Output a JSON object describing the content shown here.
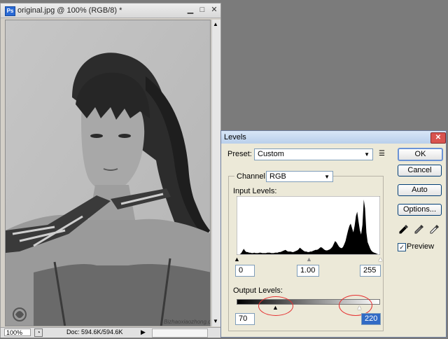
{
  "document": {
    "ps_icon_label": "Ps",
    "title": "original.jpg @ 100% (RGB/8) *",
    "zoom": "100%",
    "status": "Doc: 594.6K/594.6K",
    "watermark": "Bizhaoxiaozhong.com.vn"
  },
  "levels": {
    "title": "Levels",
    "preset_label": "Preset:",
    "preset_value": "Custom",
    "channel_label": "Channel:",
    "channel_value": "RGB",
    "input_levels_label": "Input Levels:",
    "input_black": "0",
    "input_gamma": "1.00",
    "input_white": "255",
    "output_levels_label": "Output Levels:",
    "output_black": "70",
    "output_white": "220",
    "buttons": {
      "ok": "OK",
      "cancel": "Cancel",
      "auto": "Auto",
      "options": "Options..."
    },
    "preview_label": "Preview",
    "preview_checked": true,
    "check_mark": "✓",
    "histogram_profile": [
      0,
      0,
      0,
      2,
      6,
      10,
      6,
      4,
      4,
      3,
      3,
      2,
      2,
      3,
      2,
      2,
      2,
      3,
      3,
      2,
      2,
      2,
      2,
      3,
      3,
      3,
      2,
      2,
      2,
      3,
      3,
      3,
      4,
      4,
      5,
      6,
      7,
      8,
      6,
      5,
      5,
      5,
      4,
      4,
      5,
      6,
      7,
      9,
      12,
      10,
      8,
      6,
      5,
      5,
      4,
      4,
      5,
      5,
      6,
      7,
      8,
      8,
      9,
      11,
      13,
      12,
      10,
      8,
      7,
      7,
      8,
      9,
      11,
      14,
      19,
      24,
      22,
      18,
      14,
      12,
      11,
      13,
      18,
      24,
      34,
      44,
      52,
      56,
      48,
      40,
      52,
      70,
      78,
      60,
      44,
      36,
      54,
      100,
      84,
      40,
      22,
      16,
      10,
      6,
      4,
      3,
      2,
      1,
      0,
      0
    ]
  }
}
